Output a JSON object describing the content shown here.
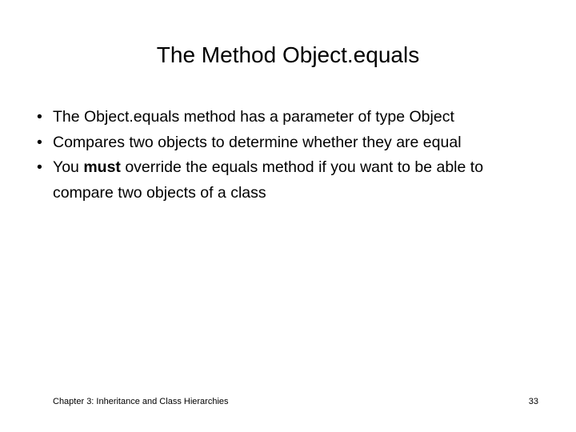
{
  "slide": {
    "title": "The Method Object.equals",
    "background_color": "#ffffff",
    "text_color": "#000000",
    "bullet_marker": "•",
    "bullets": [
      {
        "alignment": "justify",
        "text_before_bold": "The Object.equals method has a parameter of type Object",
        "bold": "",
        "text_after_bold": ""
      },
      {
        "alignment": "justify",
        "text_before_bold": "Compares two objects to determine whether they are equal",
        "bold": "",
        "text_after_bold": ""
      },
      {
        "alignment": "left",
        "text_before_bold": "You ",
        "bold": "must",
        "text_after_bold": " override the equals method if you want to be able to compare two objects of a class"
      }
    ],
    "footer": {
      "chapter": "Chapter 3: Inheritance and Class Hierarchies",
      "page_number": "33"
    }
  }
}
